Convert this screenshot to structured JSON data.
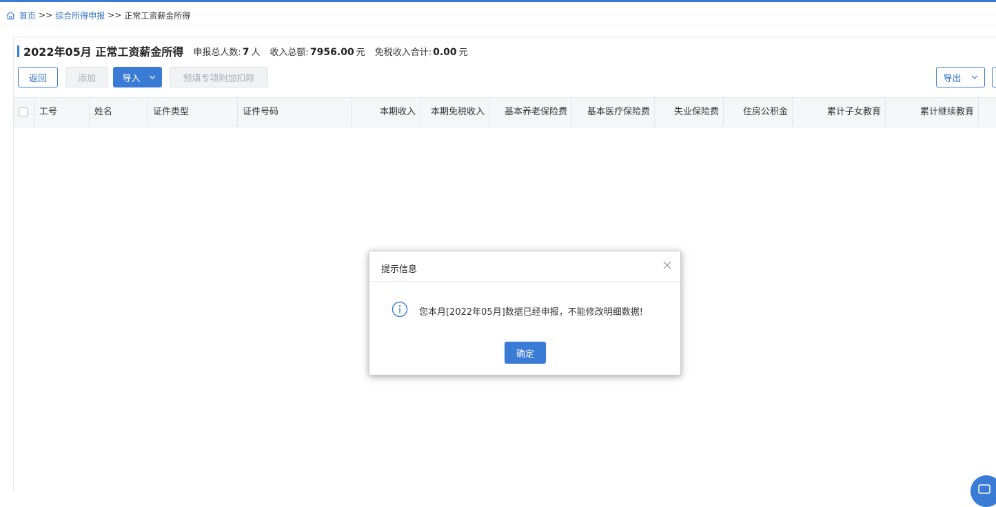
{
  "breadcrumb": {
    "home": "首页",
    "sep1": ">>",
    "level2": "综合所得申报",
    "sep2": ">>",
    "current": "正常工资薪金所得"
  },
  "header": {
    "title": "2022年05月 正常工资薪金所得",
    "stats": [
      {
        "label": "申报总人数:",
        "value": "7",
        "unit": "人"
      },
      {
        "label": "收入总额:",
        "value": "7956.00",
        "unit": "元"
      },
      {
        "label": "免税收入合计:",
        "value": "0.00",
        "unit": "元"
      }
    ]
  },
  "toolbar": {
    "return_label": "返回",
    "add_label": "添加",
    "import_label": "导入",
    "prefill_label": "预填专项附加扣除",
    "export_label": "导出"
  },
  "table": {
    "columns": [
      "工号",
      "姓名",
      "证件类型",
      "证件号码",
      "本期收入",
      "本期免税收入",
      "基本养老保险费",
      "基本医疗保险费",
      "失业保险费",
      "住房公积金",
      "累计子女教育",
      "累计继续教育"
    ]
  },
  "dialog": {
    "title": "提示信息",
    "message": "您本月[2022年05月]数据已经申报，不能修改明细数据!",
    "ok_label": "确定"
  },
  "colors": {
    "accent": "#3a7bd5",
    "link": "#2f6fbf",
    "header_bg": "#f4f6f8",
    "disabled_bg": "#f1f2f4"
  },
  "icons": {
    "home": "home-icon",
    "info": "info-icon",
    "close": "close-icon",
    "caret": "chevron-down-icon",
    "help": "chat-help-icon"
  }
}
